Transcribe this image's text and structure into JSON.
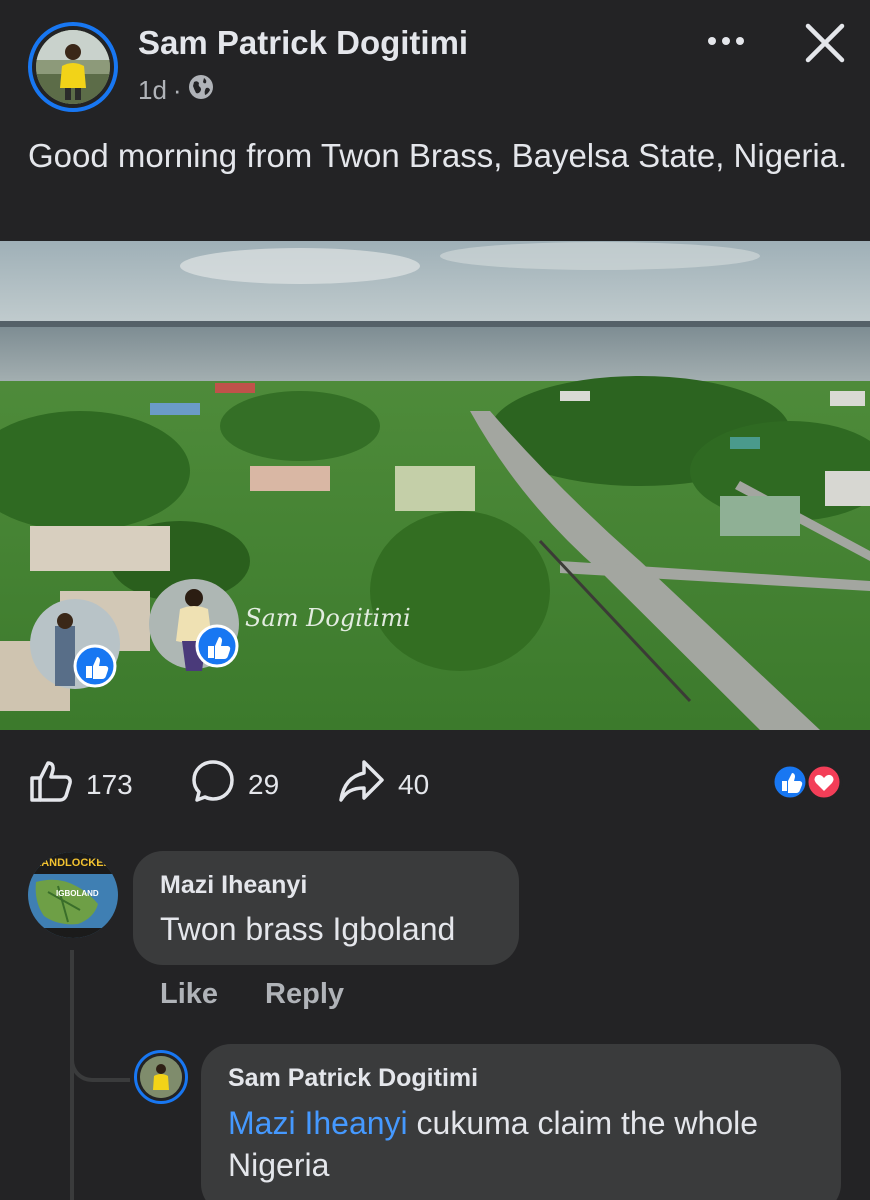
{
  "post": {
    "author": "Sam Patrick Dogitimi",
    "time": "1d",
    "separator": "·",
    "privacy_icon": "globe-icon",
    "text": "Good morning from Twon Brass, Bayelsa State, Nigeria.",
    "photo_watermark": "Sam Dogitimi"
  },
  "actions": {
    "like_count": "173",
    "comment_count": "29",
    "share_count": "40",
    "reaction_icons": [
      "like-reaction-icon",
      "love-reaction-icon"
    ]
  },
  "comments": [
    {
      "author": "Mazi Iheanyi",
      "text": "Twon brass Igboland",
      "like_label": "Like",
      "reply_label": "Reply",
      "avatar_text": [
        "LANDLOCKED",
        "IGBOLAND"
      ]
    }
  ],
  "reply": {
    "author": "Sam Patrick Dogitimi",
    "mention": "Mazi Iheanyi",
    "text": " cukuma claim the whole Nigeria"
  },
  "colors": {
    "background": "#232325",
    "bubble": "#3a3b3c",
    "accent": "#1877f2",
    "mention": "#4599ff",
    "love": "#f33e58"
  }
}
